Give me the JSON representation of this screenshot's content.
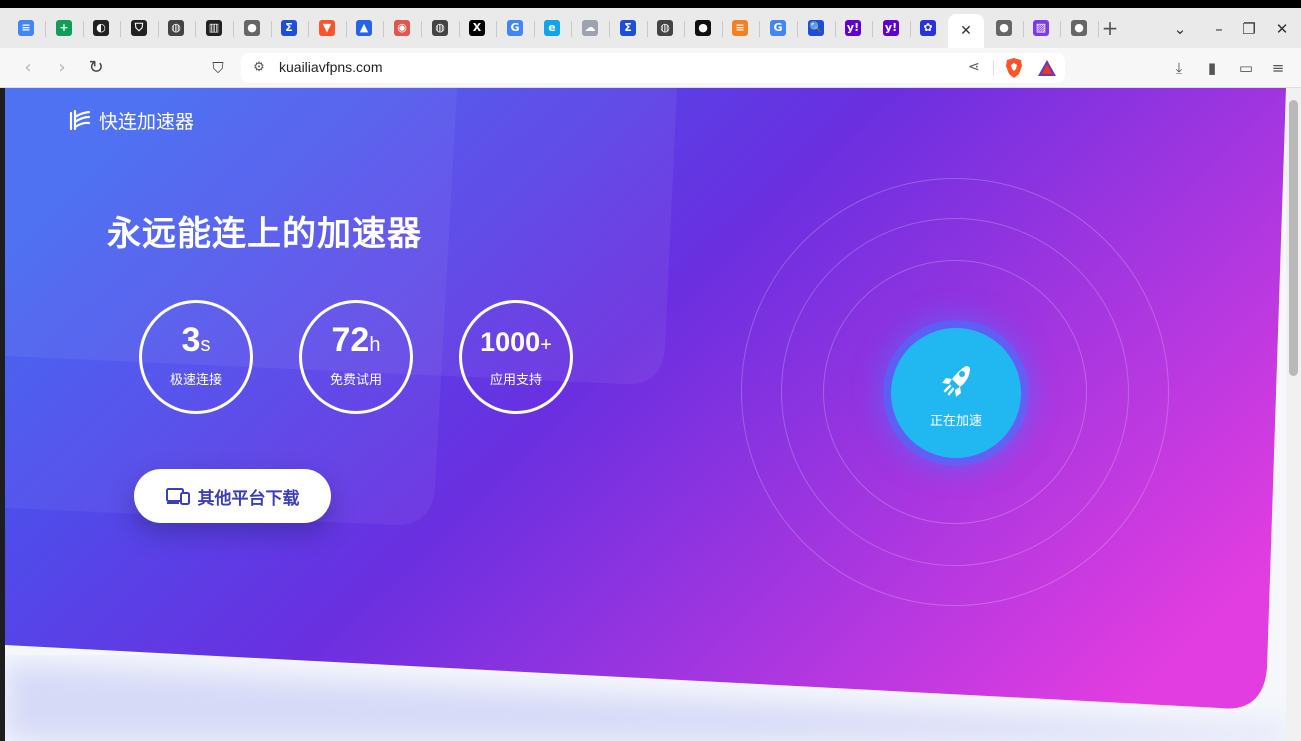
{
  "browser": {
    "url": "kuailiavfpns.com",
    "tabs": [
      {
        "icon": "docs-icon",
        "color": "#4285f4",
        "glyph": "≡"
      },
      {
        "icon": "sheets-icon",
        "color": "#0f9d58",
        "glyph": "+"
      },
      {
        "icon": "circle-swirl-icon",
        "color": "#222222",
        "glyph": "◐"
      },
      {
        "icon": "shield-icon",
        "color": "#222222",
        "glyph": "⛉"
      },
      {
        "icon": "globe-grid-icon",
        "color": "#444444",
        "glyph": "◍"
      },
      {
        "icon": "bank-icon",
        "color": "#222222",
        "glyph": "▥"
      },
      {
        "icon": "globe-icon",
        "color": "#666666",
        "glyph": "●"
      },
      {
        "icon": "sigma-icon",
        "color": "#1d4ed8",
        "glyph": "Σ"
      },
      {
        "icon": "brave-lion-icon",
        "color": "#fb542b",
        "glyph": "▼"
      },
      {
        "icon": "flask-icon",
        "color": "#2563eb",
        "glyph": "▲"
      },
      {
        "icon": "red-shield-icon",
        "color": "#e0574f",
        "glyph": "◉"
      },
      {
        "icon": "globe-grid-icon",
        "color": "#444444",
        "glyph": "◍"
      },
      {
        "icon": "x-logo-icon",
        "color": "#000000",
        "glyph": "X"
      },
      {
        "icon": "google-icon",
        "color": "#4285f4",
        "glyph": "G"
      },
      {
        "icon": "edge-icon",
        "color": "#0ea5e9",
        "glyph": "e"
      },
      {
        "icon": "cloud-icon",
        "color": "#9ca3af",
        "glyph": "☁"
      },
      {
        "icon": "sigma-icon",
        "color": "#1d4ed8",
        "glyph": "Σ"
      },
      {
        "icon": "globe-grid-icon",
        "color": "#444444",
        "glyph": "◍"
      },
      {
        "icon": "github-icon",
        "color": "#111111",
        "glyph": "●"
      },
      {
        "icon": "stackoverflow-icon",
        "color": "#f48024",
        "glyph": "≡"
      },
      {
        "icon": "google-icon",
        "color": "#4285f4",
        "glyph": "G"
      },
      {
        "icon": "magnifier-icon",
        "color": "#1d4ed8",
        "glyph": "🔍"
      },
      {
        "icon": "yahoo-icon",
        "color": "#6001d2",
        "glyph": "y!"
      },
      {
        "icon": "yahoo-icon",
        "color": "#6001d2",
        "glyph": "y!"
      },
      {
        "icon": "baidu-paw-icon",
        "color": "#2932e1",
        "glyph": "✿"
      },
      {
        "icon": "close-icon",
        "color": "#333333",
        "glyph": "✕",
        "active": true
      },
      {
        "icon": "globe-icon",
        "color": "#666666",
        "glyph": "●"
      },
      {
        "icon": "vpn-site-icon",
        "color": "#7c3aed",
        "glyph": "▨"
      },
      {
        "icon": "globe-icon",
        "color": "#666666",
        "glyph": "●"
      }
    ],
    "new_tab_glyph": "+",
    "tab_list_glyph": "⌄",
    "minimize_glyph": "–",
    "restore_glyph": "❐",
    "close_glyph": "✕"
  },
  "page": {
    "brand": "快连加速器",
    "headline": "永远能连上的加速器",
    "stats": [
      {
        "value": "3",
        "unit": "s",
        "label": "极速连接"
      },
      {
        "value": "72",
        "unit": "h",
        "label": "免费试用"
      },
      {
        "value": "1000",
        "unit": "+",
        "label": "应用支持"
      }
    ],
    "download_button": "其他平台下载",
    "accelerate_status": "正在加速",
    "colors": {
      "gradient_start": "#3a5ff0",
      "gradient_mid": "#6a2fe0",
      "gradient_end": "#e03be0",
      "core": "#21b8f2"
    }
  }
}
